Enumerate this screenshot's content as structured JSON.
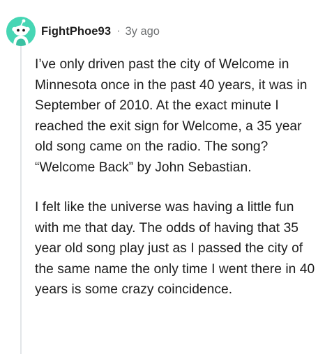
{
  "comment": {
    "username": "FightPhoe93",
    "separator": "·",
    "age": "3y ago",
    "avatar_icon": "snoo-avatar-icon",
    "avatar_color": "#46d6b4",
    "paragraphs": [
      "I’ve only driven past the city of Welcome in Minnesota once in the past 40 years, it was in September of 2010. At the exact minute I reached the exit sign for Welcome, a 35 year old song came on the radio. The song? “Welcome Back” by John Sebastian.",
      "I felt like the universe was having a little fun with me that day. The odds of having that 35 year old song play just as I passed the city of the same name the only time I went there in 40 years is some crazy coincidence."
    ]
  }
}
